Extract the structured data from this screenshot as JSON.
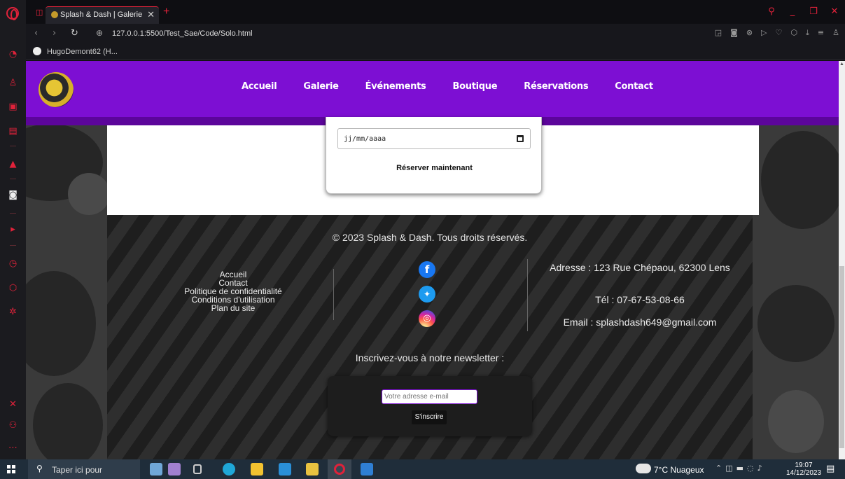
{
  "browser": {
    "tab_title": "Splash & Dash | Galerie",
    "tab_close": "✕",
    "new_tab": "+",
    "url": "127.0.0.1:5500/Test_Sae/Code/Solo.html",
    "bookmark_label": "HugoDemont62 (H...",
    "accent_color": "#e0223a"
  },
  "site": {
    "nav_color": "#7d0fd3",
    "nav_links": [
      "Accueil",
      "Galerie",
      "Événements",
      "Boutique",
      "Réservations",
      "Contact"
    ],
    "reservation": {
      "date_placeholder": "jj/mm/aaaa",
      "reserve_label": "Réserver maintenant"
    },
    "footer": {
      "copyright": "© 2023 Splash & Dash. Tous droits réservés.",
      "links": [
        "Accueil",
        "Contact",
        "Politique de confidentialité",
        "Conditions d'utilisation",
        "Plan du site"
      ],
      "social_icons": [
        "facebook-icon",
        "twitter-icon",
        "instagram-icon"
      ],
      "address": "Adresse : 123 Rue Chépaou, 62300 Lens",
      "phone": "Tél : 07-67-53-08-66",
      "email": "Email : splashdash649@gmail.com",
      "newsletter_title": "Inscrivez-vous à notre newsletter :",
      "email_placeholder": "Votre adresse e-mail",
      "subscribe_label": "S'inscrire"
    }
  },
  "taskbar": {
    "search_text": "Taper ici pour",
    "weather": "7°C Nuageux",
    "time": "19:07",
    "date": "14/12/2023"
  }
}
